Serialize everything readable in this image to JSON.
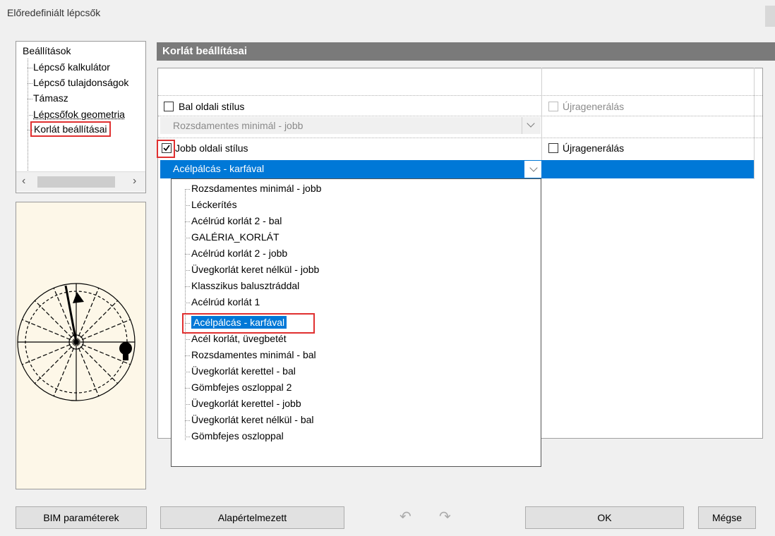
{
  "window": {
    "title": "Előredefiniált lépcsők"
  },
  "tree": {
    "root": "Beállítások",
    "items": [
      {
        "label": "Lépcső kalkulátor"
      },
      {
        "label": "Lépcső tulajdonságok"
      },
      {
        "label": "Támasz"
      },
      {
        "label": "Lépcsőfok geometria"
      },
      {
        "label": "Korlát beállításai"
      }
    ]
  },
  "section": {
    "title": "Korlát beállításai"
  },
  "left_side": {
    "label": "Bal oldali stílus",
    "checked": false,
    "style_value": "Rozsdamentes minimál - jobb",
    "regen_label": "Újragenerálás",
    "regen_checked": false
  },
  "right_side": {
    "label": "Jobb oldali stílus",
    "checked": true,
    "style_value": "Acélpálcás - karfával",
    "regen_label": "Újragenerálás",
    "regen_checked": false
  },
  "dropdown": {
    "options": [
      "Rozsdamentes minimál - jobb",
      "Léckerítés",
      "Acélrúd korlát 2 - bal",
      "GALÉRIA_KORLÁT",
      "Acélrúd korlát 2 - jobb",
      "Üvegkorlát keret nélkül - jobb",
      "Klasszikus balusztráddal",
      "Acélrúd korlát 1",
      "Acélpálcás - karfával",
      "Acél korlát, üvegbetét",
      "Rozsdamentes minimál - bal",
      "Üvegkorlát kerettel - bal",
      "Gömbfejes oszloppal 2",
      "Üvegkorlát kerettel - jobb",
      "Üvegkorlát keret nélkül - bal",
      "Gömbfejes oszloppal"
    ],
    "selected": "Acélpálcás - karfával"
  },
  "buttons": {
    "bim": "BIM paraméterek",
    "default": "Alapértelmezett",
    "ok": "OK",
    "cancel": "Mégse"
  },
  "icons": {
    "undo": "undo-icon",
    "redo": "redo-icon",
    "check": "check-icon"
  },
  "colors": {
    "selection": "#0078d7",
    "highlight_box": "#e03030",
    "header": "#7a7a7a"
  }
}
